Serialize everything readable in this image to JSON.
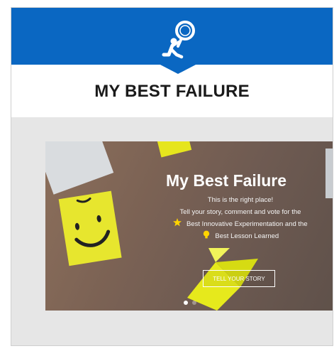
{
  "header": {
    "title": "MY BEST FAILURE",
    "brand_color": "#0a67c2",
    "logo_icon": "person-with-magnifying-glass-icon"
  },
  "hero": {
    "title": "My Best Failure",
    "line1": "This is the right place!",
    "line2": "Tell your story, comment and vote for the",
    "line3": "Best Innovative Experimentation and the",
    "line4": "Best Lesson Learned",
    "cta_label": "TELL YOUR STORY",
    "carousel_active_index": 1,
    "carousel_total": 2,
    "icons": [
      "smiley-note-icon",
      "star-icon",
      "lightbulb-icon"
    ]
  }
}
